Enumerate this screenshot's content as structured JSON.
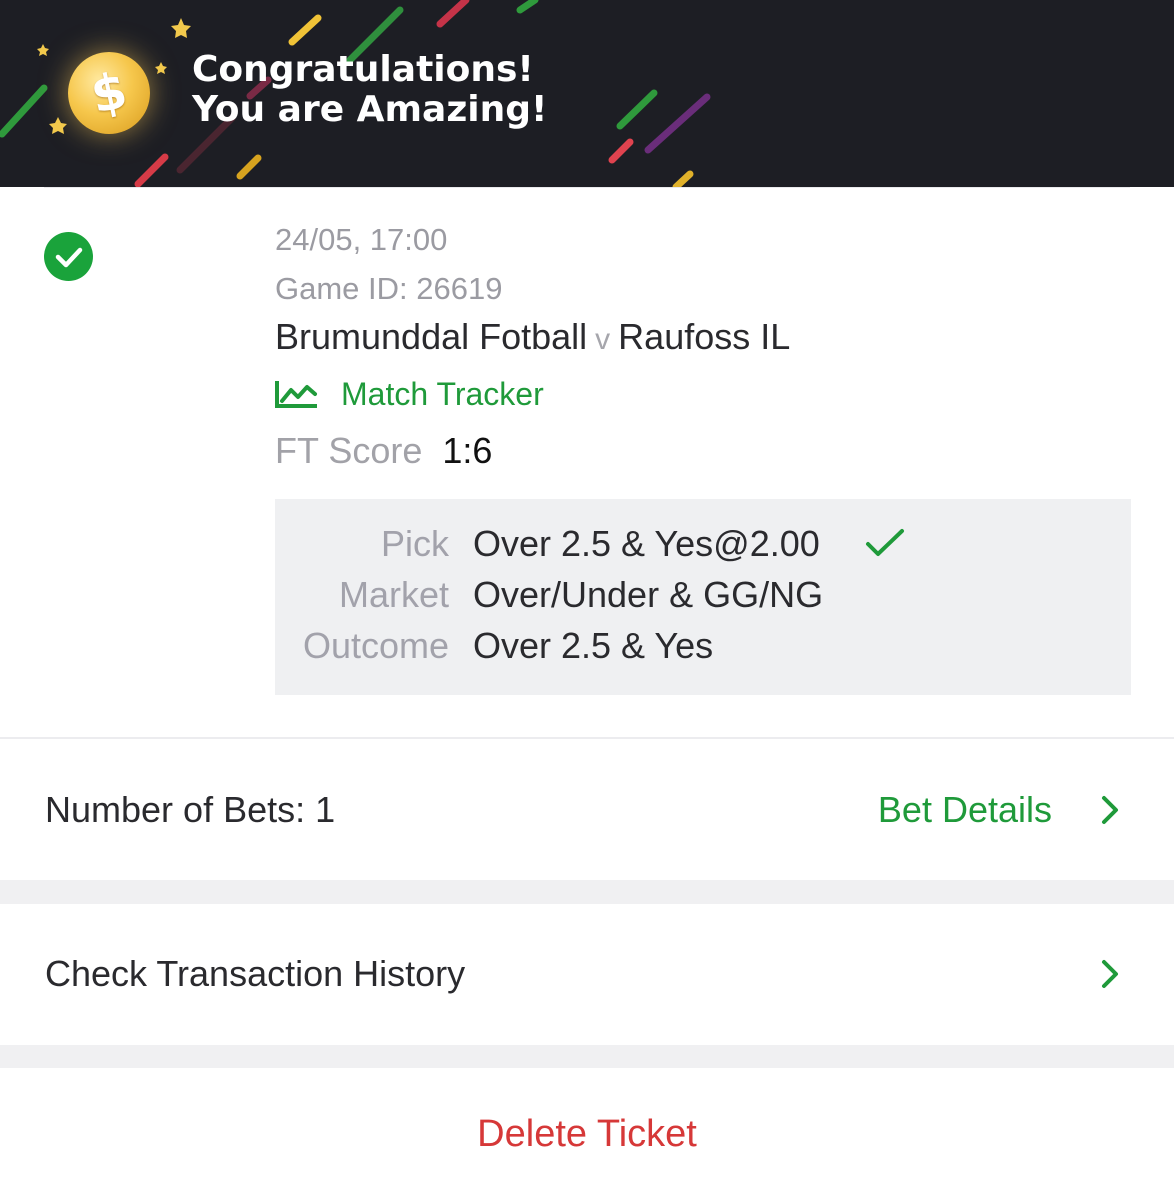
{
  "banner": {
    "title_line1": "Congratulations!",
    "title_line2": "You are Amazing!",
    "coin_symbol": "$",
    "background": "#1d1e24"
  },
  "ticket": {
    "status": "won",
    "date": "24/05, 17:00",
    "game_id": "Game ID: 26619",
    "home_team": "Brumunddal Fotball",
    "vs": "v",
    "away_team": "Raufoss IL",
    "match_tracker_label": "Match Tracker",
    "ft_score_label": "FT Score",
    "ft_score_value": "1:6",
    "pick_label": "Pick",
    "pick_value": "Over 2.5 & Yes@2.00",
    "market_label": "Market",
    "market_value": "Over/Under & GG/NG",
    "outcome_label": "Outcome",
    "outcome_value": "Over 2.5 & Yes"
  },
  "summary": {
    "number_of_bets": "Number of Bets: 1",
    "bet_details_label": "Bet Details"
  },
  "history": {
    "label": "Check Transaction History"
  },
  "actions": {
    "delete_label": "Delete Ticket"
  },
  "colors": {
    "accent_green": "#1f9a3a",
    "danger_red": "#d63838",
    "muted_gray": "#9b9ba2"
  },
  "icons": {
    "status": "check-circle-icon",
    "tracker": "chart-line-icon",
    "pick_result": "checkmark-icon",
    "chevron": "chevron-right-icon"
  }
}
